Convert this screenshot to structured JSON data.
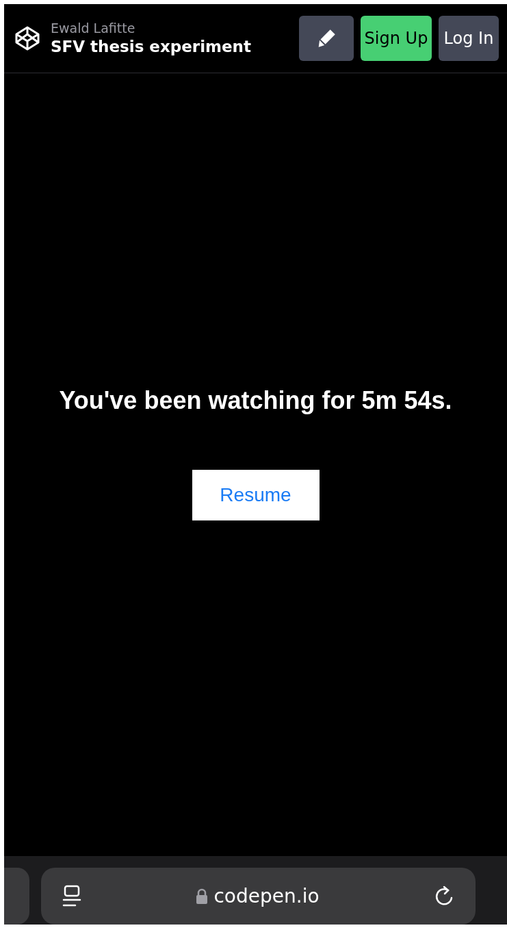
{
  "header": {
    "author": "Ewald Lafitte",
    "title": "SFV thesis experiment",
    "buttons": [
      {
        "kind": "edit"
      },
      {
        "kind": "signup",
        "label": "Sign Up"
      },
      {
        "kind": "login",
        "label": "Log In"
      }
    ]
  },
  "content": {
    "message": "You've been watching for 5m 54s.",
    "button": "Resume"
  },
  "browser_bar": {
    "url": "codepen.io"
  }
}
